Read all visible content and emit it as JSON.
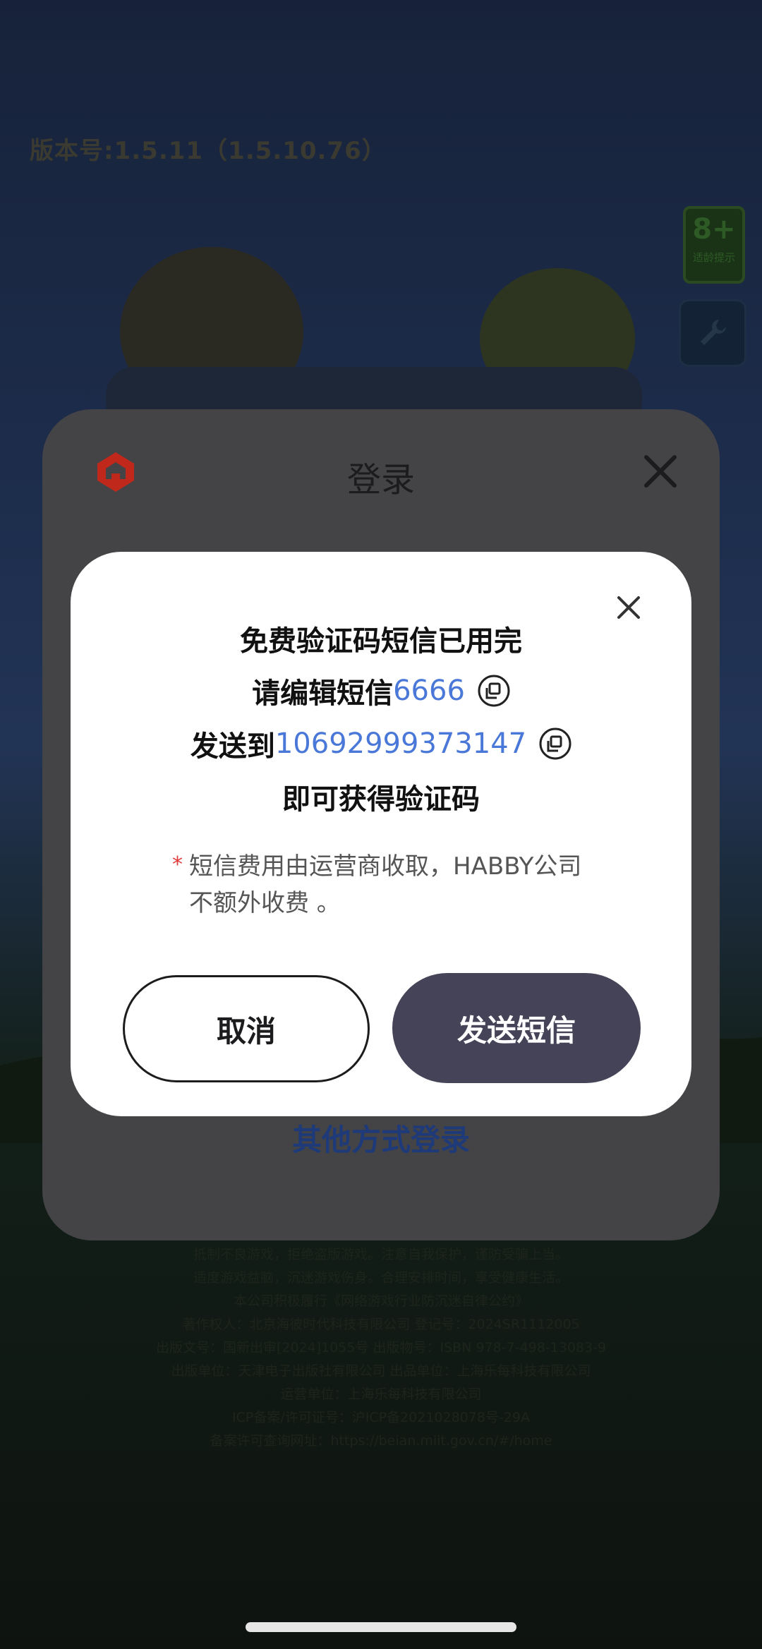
{
  "background": {
    "version_label": "版本号:1.5.11（1.5.10.76）",
    "age_rating": {
      "big": "8+",
      "small": "适龄提示"
    },
    "legal_lines": [
      "抵制不良游戏，拒绝盗版游戏。注意自我保护，谨防受骗上当。",
      "适度游戏益脑，沉迷游戏伤身。合理安排时间，享受健康生活。",
      "本公司积极履行《网络游戏行业防沉迷自律公约》",
      "著作权人：北京海彼时代科技有限公司  登记号：2024SR1112005",
      "出版文号：国新出审[2024]1055号  出版物号：ISBN 978-7-498-13083-9",
      "出版单位：天津电子出版社有限公司  出品单位：上海乐每科技有限公司",
      "运营单位：上海乐每科技有限公司",
      "ICP备案/许可证号：沪ICP备2021028078号-29A",
      "备案许可查询网址：https://beian.miit.gov.cn/#/home"
    ]
  },
  "login": {
    "title": "登录",
    "other_methods": "其他方式登录"
  },
  "dialog": {
    "line1": "免费验证码短信已用完",
    "line2_prefix": "请编辑短信",
    "line2_code": "6666",
    "line3_prefix": "发送到",
    "line3_number": "10692999373147",
    "line4": "即可获得验证码",
    "note_star": "*",
    "note_text": "短信费用由运营商收取，HABBY公司不额外收费 。",
    "cancel_label": "取消",
    "send_label": "发送短信"
  },
  "colors": {
    "accent_blue": "#4a78d8",
    "send_button": "#454357",
    "note_star": "#e03a3a",
    "logo_red": "#c0281c"
  },
  "icons": [
    "copy-icon",
    "close-icon",
    "habby-logo-icon",
    "wrench-icon"
  ]
}
